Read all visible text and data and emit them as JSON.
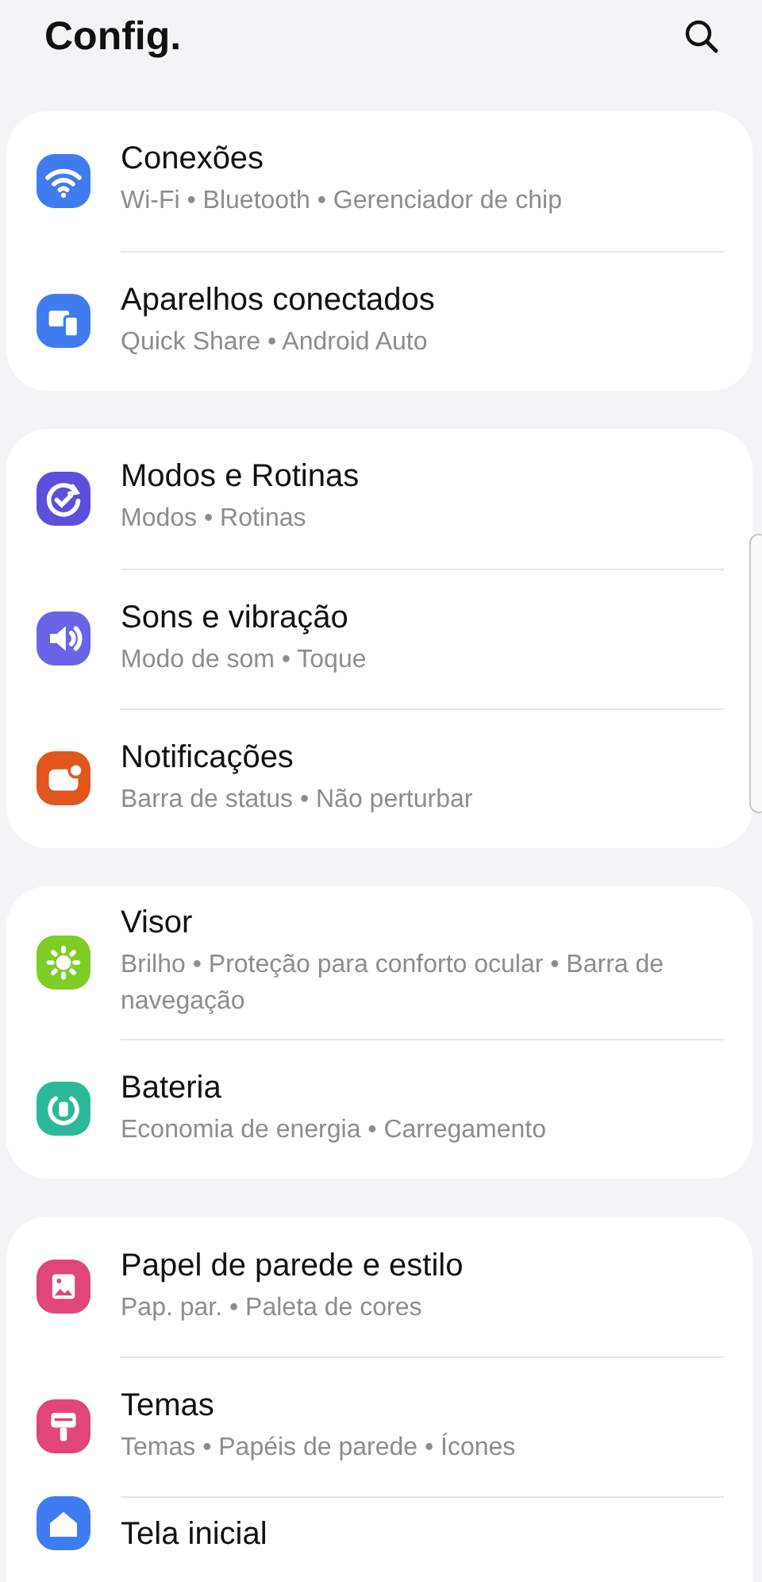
{
  "header": {
    "title": "Config."
  },
  "groups": [
    {
      "items": [
        {
          "title": "Conexões",
          "subtitle": "Wi-Fi • Bluetooth • Gerenciador de chip",
          "color": "#3f7cf0"
        },
        {
          "title": "Aparelhos conectados",
          "subtitle": "Quick Share • Android Auto",
          "color": "#3f7cf0"
        }
      ]
    },
    {
      "items": [
        {
          "title": "Modos e Rotinas",
          "subtitle": "Modos • Rotinas",
          "color": "#5c4fdc"
        },
        {
          "title": "Sons e vibração",
          "subtitle": "Modo de som • Toque",
          "color": "#6a63e6"
        },
        {
          "title": "Notificações",
          "subtitle": "Barra de status • Não perturbar",
          "color": "#e2561e"
        }
      ]
    },
    {
      "items": [
        {
          "title": "Visor",
          "subtitle": "Brilho • Proteção para conforto ocular • Barra de navegação",
          "color": "#7fcc26"
        },
        {
          "title": "Bateria",
          "subtitle": "Economia de energia • Carregamento",
          "color": "#2bb99a"
        }
      ]
    },
    {
      "items": [
        {
          "title": "Papel de parede e estilo",
          "subtitle": "Pap. par. • Paleta de cores",
          "color": "#e0467a"
        },
        {
          "title": "Temas",
          "subtitle": "Temas • Papéis de parede • Ícones",
          "color": "#e0467a"
        },
        {
          "title": "Tela inicial",
          "color": "#3f7cf0"
        }
      ]
    }
  ]
}
